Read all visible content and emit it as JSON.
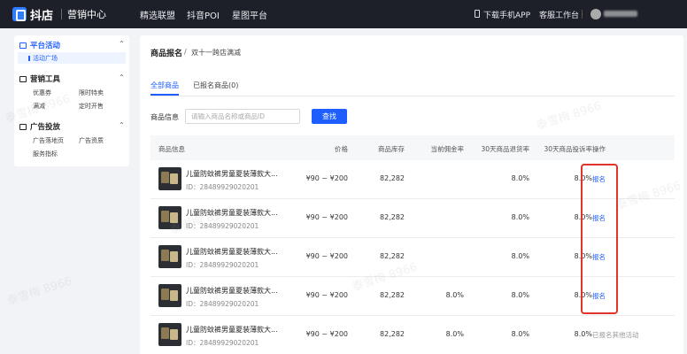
{
  "topbar": {
    "brand": "抖店",
    "subtitle": "营销中心",
    "nav": [
      "精选联盟",
      "抖音POI",
      "星图平台"
    ],
    "download_app": "下载手机APP",
    "service_desk": "客服工作台"
  },
  "sidebar": {
    "groups": [
      {
        "title": "平台活动",
        "icon": "shield-icon",
        "items": [
          "活动广场"
        ]
      },
      {
        "title": "营销工具",
        "icon": "coupon-icon",
        "items": [
          "优惠券",
          "限时特卖",
          "满减",
          "定时开售"
        ]
      },
      {
        "title": "广告投放",
        "icon": "ad-icon",
        "items": [
          "广告落地页",
          "广告资质",
          "服务指标"
        ]
      }
    ]
  },
  "breadcrumb": {
    "root": "商品报名",
    "separator": "/",
    "current": "双十一跨店满减"
  },
  "tabs": [
    "全部商品",
    "已报名商品(0)"
  ],
  "search": {
    "label": "商品信息",
    "placeholder": "请输入商品名称或商品ID",
    "button": "查找"
  },
  "table": {
    "headers": [
      "商品信息",
      "价格",
      "商品库存",
      "当前佣金率",
      "30天商品退货率",
      "30天商品投诉率",
      "操作"
    ],
    "rows": [
      {
        "name": "儿童防蚊裤男童夏装薄款大...",
        "id": "ID：28489929020201",
        "price": "¥90 ~ ¥200",
        "stock": "82,282",
        "commission": "",
        "return_rate": "8.0%",
        "complaint_rate": "8.0%",
        "action": "报名",
        "action_type": "link"
      },
      {
        "name": "儿童防蚊裤男童夏装薄款大...",
        "id": "ID：28489929020201",
        "price": "¥90 ~ ¥200",
        "stock": "82,282",
        "commission": "",
        "return_rate": "8.0%",
        "complaint_rate": "8.0%",
        "action": "报名",
        "action_type": "link"
      },
      {
        "name": "儿童防蚊裤男童夏装薄款大...",
        "id": "ID：28489929020201",
        "price": "¥90 ~ ¥200",
        "stock": "82,282",
        "commission": "",
        "return_rate": "8.0%",
        "complaint_rate": "8.0%",
        "action": "报名",
        "action_type": "link"
      },
      {
        "name": "儿童防蚊裤男童夏装薄款大...",
        "id": "ID：28489929020201",
        "price": "¥90 ~ ¥200",
        "stock": "82,282",
        "commission": "8.0%",
        "return_rate": "8.0%",
        "complaint_rate": "8.0%",
        "action": "报名",
        "action_type": "link"
      },
      {
        "name": "儿童防蚊裤男童夏装薄款大...",
        "id": "ID：28489929020201",
        "price": "¥90 ~ ¥200",
        "stock": "82,282",
        "commission": "8.0%",
        "return_rate": "8.0%",
        "complaint_rate": "8.0%",
        "action": "已报名其他活动",
        "action_type": "muted"
      }
    ]
  },
  "watermark": "泰雪梅 8966",
  "colors": {
    "accent": "#1e5eff",
    "topbar": "#1d2029",
    "highlight": "#e0332a"
  }
}
